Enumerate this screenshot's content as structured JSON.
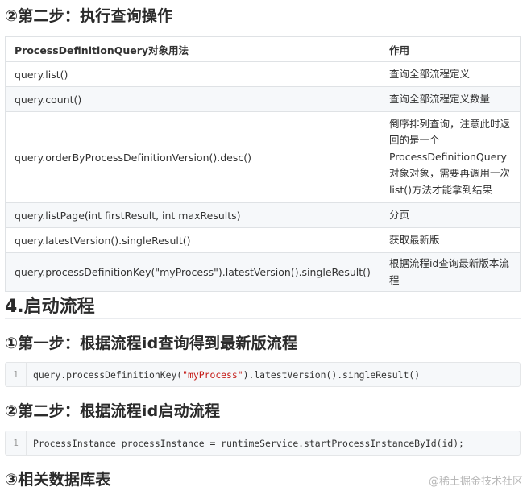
{
  "headings": {
    "step2_query": "②第二步：执行查询操作",
    "section4": "4.启动流程",
    "step1_find": "①第一步：根据流程id查询得到最新版流程",
    "step2_start": "②第二步：根据流程id启动流程",
    "step3_tables": "③相关数据库表"
  },
  "table": {
    "headers": [
      "ProcessDefinitionQuery对象用法",
      "作用"
    ],
    "rows": [
      [
        "query.list()",
        "查询全部流程定义"
      ],
      [
        "query.count()",
        "查询全部流程定义数量"
      ],
      [
        "query.orderByProcessDefinitionVersion().desc()",
        "倒序排列查询，注意此时返回的是一个ProcessDefinitionQuery对象对象，需要再调用一次list()方法才能拿到结果"
      ],
      [
        "query.listPage(int firstResult, int maxResults)",
        "分页"
      ],
      [
        "query.latestVersion().singleResult()",
        "获取最新版"
      ],
      [
        "query.processDefinitionKey(\"myProcess\").latestVersion().singleResult()",
        "根据流程id查询最新版本流程"
      ]
    ]
  },
  "code1": {
    "line": "1",
    "before": "query.processDefinitionKey(",
    "string": "\"myProcess\"",
    "after": ").latestVersion().singleResult()"
  },
  "code2": {
    "line": "1",
    "text": "ProcessInstance processInstance = runtimeService.startProcessInstanceById(id);"
  },
  "watermark": "@稀土掘金技术社区"
}
